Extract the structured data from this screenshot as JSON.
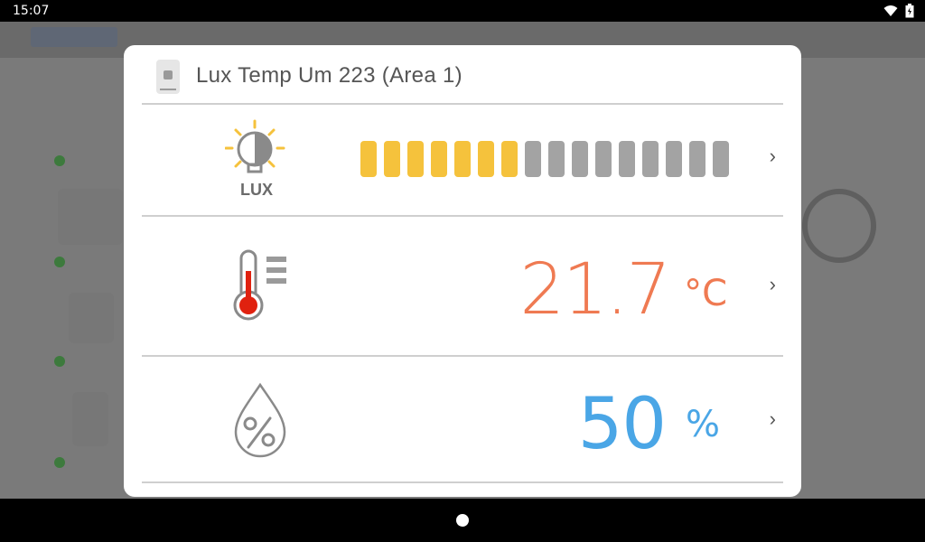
{
  "status_bar": {
    "time": "15:07",
    "icons": [
      "wifi-icon",
      "battery-icon"
    ]
  },
  "dialog": {
    "title": "Lux Temp Um 223 (Area 1)",
    "device_icon": "sensor-device-icon",
    "lux": {
      "icon": "lux-bulb-icon",
      "label": "LUX",
      "level_filled": 7,
      "level_total": 16,
      "filled_color": "#f5c23c",
      "empty_color": "#a3a3a3",
      "chevron": "›"
    },
    "temperature": {
      "icon": "thermometer-icon",
      "value": "21.7",
      "unit": "°C",
      "color": "#ef7a52",
      "chevron": "›"
    },
    "humidity": {
      "icon": "humidity-drop-icon",
      "value": "50",
      "unit": "%",
      "color": "#4aa6e6",
      "chevron": "›"
    }
  },
  "nav_bar": {
    "home": "home-button"
  }
}
